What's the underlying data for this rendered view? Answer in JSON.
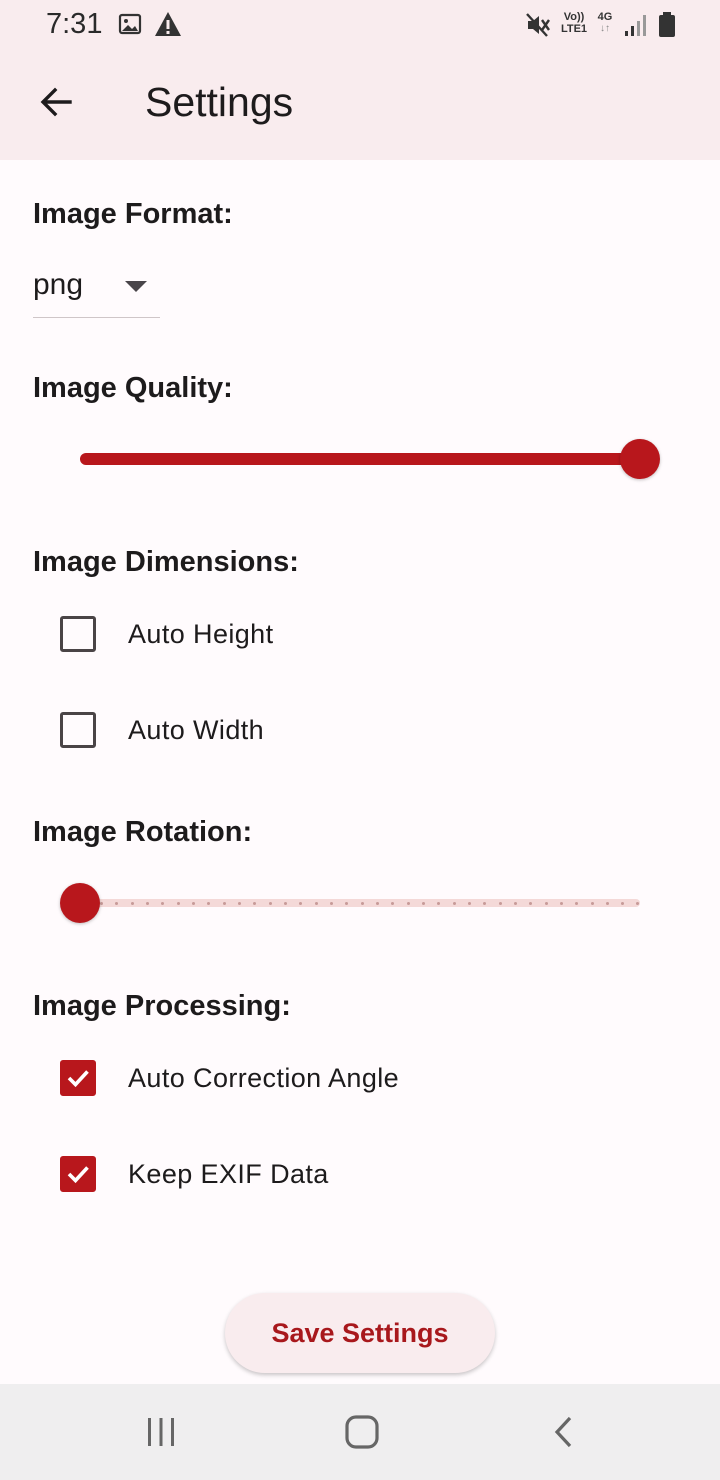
{
  "status_bar": {
    "time": "7:31",
    "icons": [
      "image-icon",
      "warning-icon",
      "mute-icon",
      "volte-icon",
      "4g-icon",
      "signal-icon",
      "battery-icon"
    ],
    "volte_label_top": "Vo))",
    "volte_label_bottom": "LTE1",
    "network_label": "4G"
  },
  "app_bar": {
    "title": "Settings",
    "back_icon": "arrow-back-icon"
  },
  "sections": {
    "format": {
      "label": "Image Format:",
      "selected": "png"
    },
    "quality": {
      "label": "Image Quality:",
      "value_fraction": 1.0
    },
    "dimensions": {
      "label": "Image Dimensions:",
      "options": [
        {
          "label": "Auto Height",
          "checked": false
        },
        {
          "label": "Auto Width",
          "checked": false
        }
      ]
    },
    "rotation": {
      "label": "Image Rotation:",
      "value_fraction": 0.0
    },
    "processing": {
      "label": "Image Processing:",
      "options": [
        {
          "label": "Auto Correction Angle",
          "checked": true
        },
        {
          "label": "Keep EXIF Data",
          "checked": true
        }
      ]
    }
  },
  "save_button": {
    "label": "Save Settings"
  },
  "colors": {
    "accent": "#b8171c",
    "app_bar_bg": "#f9ecee",
    "page_bg": "#fffbfd",
    "track_inactive": "#f4d9d8"
  },
  "nav_bar": {
    "icons": [
      "recent-apps-icon",
      "home-icon",
      "back-icon"
    ]
  }
}
